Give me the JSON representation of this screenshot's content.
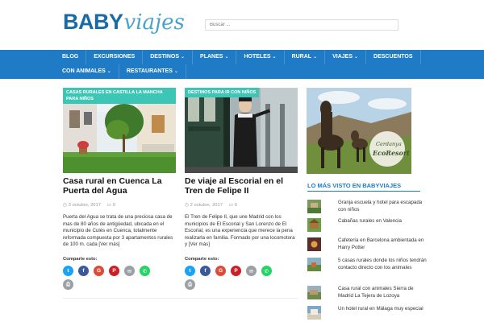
{
  "logo": {
    "bold": "BABY",
    "italic": "viajes"
  },
  "search": {
    "placeholder": "Buscar ..."
  },
  "nav": {
    "row1": [
      "BLOG",
      "EXCURSIONES",
      "DESTINOS",
      "PLANES",
      "HOTELES",
      "RURAL",
      "VIAJES",
      "DESCUENTOS"
    ],
    "row2": [
      "CON ANIMALES",
      "RESTAURANTES"
    ]
  },
  "posts": [
    {
      "category": "CASAS RURALES EN CASTILLA LA MANCHA PARA NIÑOS",
      "title": "Casa rural en Cuenca La Puerta del Agua",
      "date": "3 octubre, 2017",
      "comments": "0",
      "excerpt": "Puerta del Agua se trata de una preciosa casa de mas de 80 años de antigüedad, ubicada en el municipio  de Culés en Cuenca, totalmente reformada compuesta por 3 apartamentos rurales de 100 m. cada [Ver más]",
      "share_label": "Comparte esto:"
    },
    {
      "category": "DESTINOS PARA IR CON NIÑOS",
      "title": "De viaje al Escorial en el Tren de Felipe II",
      "date": "2 octubre, 2017",
      "comments": "0",
      "excerpt": "El Tren de Felipe II, que une Madrid con los municipios de El Escorial y San Lorenzo de El Escorial, es una experiencia que merece la pena realizarla en familia. Formado por una locomotora y [Ver más]",
      "share_label": "Comparte esto:"
    }
  ],
  "sidebar": {
    "ad_line1": "Cerdanya",
    "ad_line2": "EcoResort",
    "title": "LO MÁS VISTO EN BABYVIAJES",
    "items": [
      "Granja escuela y hotel para escapada con niños",
      "Cabañas rurales en Valencia",
      "Cafetería en Barcelona ambientada en Harry Potter",
      "5 casas rurales donde los niños tendrán contacto directo con los animales",
      "Casa rural con animales Sierra de Madrid La Tejera de Lozoya",
      "Un hotel rural en Málaga muy especial"
    ]
  },
  "colors": {
    "nav": "#1f7bc6",
    "category_badge": "#3dc6b5",
    "logo_dark": "#1a6aa6",
    "logo_light": "#4aa3c9"
  },
  "share_icons": [
    "twitter-icon",
    "facebook-icon",
    "google-plus-icon",
    "pinterest-icon",
    "email-icon",
    "whatsapp-icon",
    "print-icon"
  ]
}
